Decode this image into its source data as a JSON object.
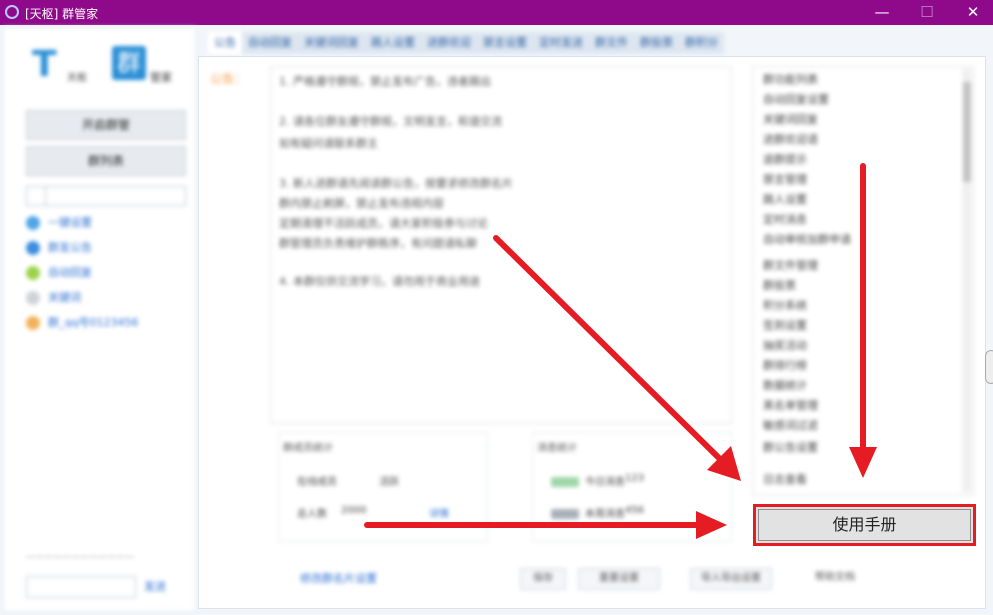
{
  "window": {
    "title": "[天枢] 群管家",
    "controls": {
      "minimize": "—",
      "maximize": "☐",
      "close": "✕"
    }
  },
  "sidebar": {
    "logo": {
      "part1": "T",
      "part1_small": "天枢",
      "part2": "群",
      "part2_small": "管家"
    },
    "buttons": [
      "开启群管",
      "群列表"
    ],
    "groups": [
      {
        "label": "一键设置",
        "color": "#4fa4e8"
      },
      {
        "label": "群发公告",
        "color": "#3b8de0"
      },
      {
        "label": "自动回复",
        "color": "#9bd24a"
      },
      {
        "label": "关键词",
        "color": "#cfd3d8"
      },
      {
        "label": "群_qq号0123456",
        "color": "#f0b25a"
      }
    ],
    "status_text": "————————————",
    "send_label": "发送"
  },
  "tabs": [
    "公告",
    "自动回复",
    "关键词回复",
    "踢人设置",
    "进群欢迎",
    "禁言设置",
    "定时发送",
    "群文件",
    "群投票",
    "群积分"
  ],
  "main": {
    "side_label": "公告：",
    "notice_lines": [
      "1. 严格遵守群规，禁止发布广告，违者踢出",
      "2. 请各位群友遵守群规，文明发言，和谐交流",
      "如有疑问请联系群主",
      "3. 新人进群请先阅读群公告，按要求修改群名片",
      "群内禁止刷屏，禁止发布违规内容",
      "定期清理不活跃成员，请大家积极参与讨论",
      "群管理员负责维护群秩序，有问题请私聊",
      "4. 本群仅供交流学习，请勿用于商业用途"
    ],
    "stats_a": {
      "title": "群成员统计",
      "rows": [
        [
          "在线成员",
          "活跃"
        ],
        [
          "总人数",
          "2000",
          "详情"
        ]
      ]
    },
    "stats_b": {
      "title": "消息统计",
      "rows": [
        [
          "今日消息",
          "123"
        ],
        [
          "本周消息",
          "456"
        ]
      ]
    },
    "bottom_link": "修改群名片设置",
    "bottom_buttons": [
      "保存",
      "重置设置",
      "导入导出设置",
      "帮助文档"
    ]
  },
  "right_list": [
    "群功能列表",
    "自动回复设置",
    "关键词回复",
    "进群欢迎语",
    "退群提示",
    "禁言管理",
    "踢人设置",
    "定时消息",
    "自动审核加群申请",
    "群文件管理",
    "群投票",
    "积分系统",
    "签到设置",
    "抽奖活动",
    "群排行榜",
    "数据统计",
    "黑名单管理",
    "敏感词过滤",
    "群公告设置",
    "日志查看"
  ],
  "manual_button": "使用手册",
  "colors": {
    "titlebar": "#8e0a8a",
    "annotation_red": "#e51c24",
    "link_blue": "#2a6fd1"
  }
}
